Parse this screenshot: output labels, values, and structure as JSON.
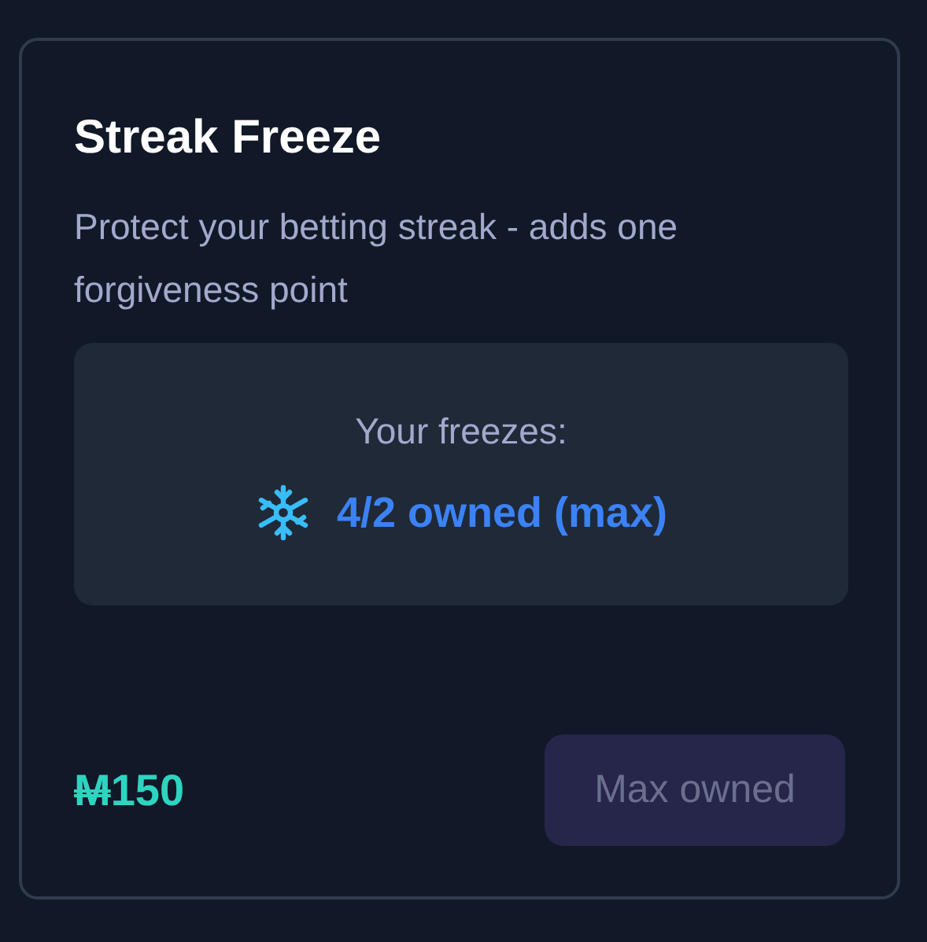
{
  "card": {
    "title": "Streak Freeze",
    "description": "Protect your betting streak - adds one forgiveness point",
    "inventory": {
      "label": "Your freezes:",
      "count": "4/2 owned (max)"
    },
    "price": {
      "currency_symbol": "M",
      "amount": "150"
    },
    "button": {
      "label": "Max owned",
      "disabled": true
    }
  }
}
